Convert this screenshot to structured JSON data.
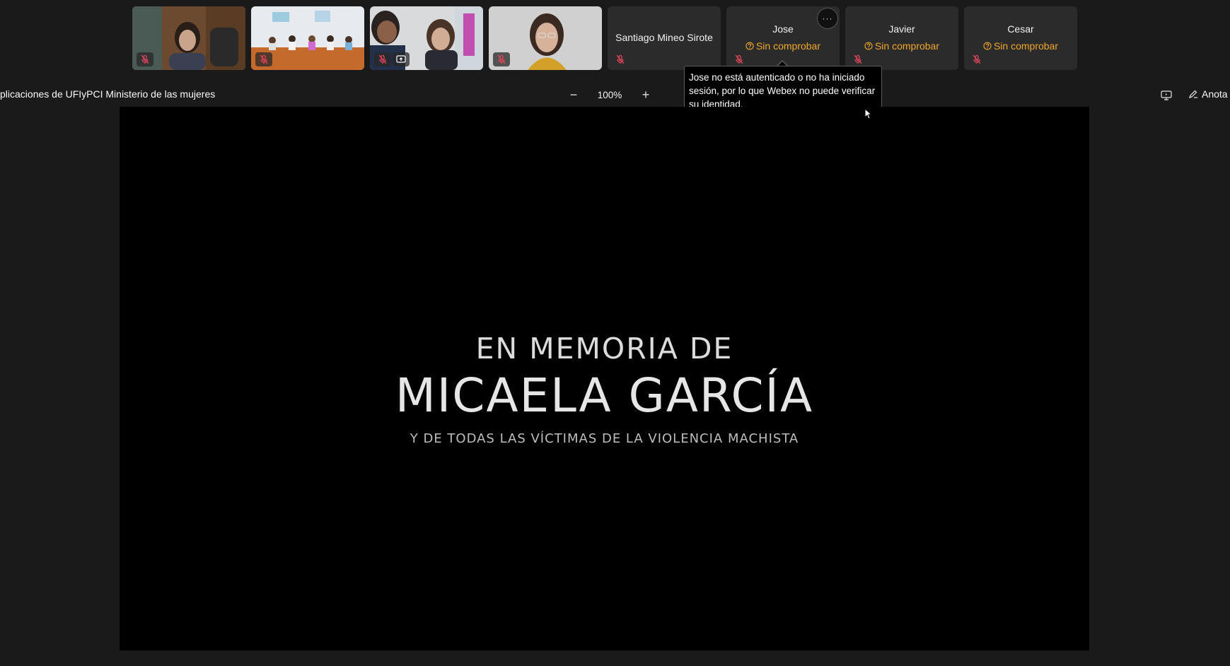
{
  "participants": [
    {
      "kind": "video",
      "muted": true,
      "active": true
    },
    {
      "kind": "video",
      "muted": true
    },
    {
      "kind": "video",
      "muted": true,
      "sharing": true
    },
    {
      "kind": "video",
      "muted": true
    },
    {
      "kind": "name",
      "name": "Santiago Mineo Sirote",
      "muted": true
    },
    {
      "kind": "name",
      "name": "Jose",
      "status": "Sin comprobar",
      "muted": true,
      "hovered": true
    },
    {
      "kind": "name",
      "name": "Javier",
      "status": "Sin comprobar",
      "muted": true
    },
    {
      "kind": "name",
      "name": "Cesar",
      "status": "Sin comprobar",
      "muted": true
    }
  ],
  "tooltip": {
    "text": "Jose no está autenticado o no ha iniciado sesión, por lo que Webex no puede verificar su identidad."
  },
  "more_button": {
    "label": "···"
  },
  "toolbar": {
    "share_title": "plicaciones de UFIyPCI Ministerio de las mujeres",
    "zoom_minus": "−",
    "zoom_value": "100%",
    "zoom_plus": "+",
    "annotate_label": "Anota"
  },
  "slide": {
    "line1": "EN MEMORIA DE",
    "line2": "MICAELA GARCÍA",
    "line3": "Y DE TODAS LAS VÍCTIMAS DE LA VIOLENCIA MACHISTA"
  },
  "colors": {
    "background": "#1a1a1a",
    "tile": "#2b2b2b",
    "status_warning": "#f2a72c",
    "mute_icon": "#e8455a"
  },
  "icons": {
    "mute": "mic-off-icon",
    "share": "screen-share-icon",
    "status": "question-circle-icon",
    "display": "display-icon",
    "annotate": "pen-icon"
  }
}
